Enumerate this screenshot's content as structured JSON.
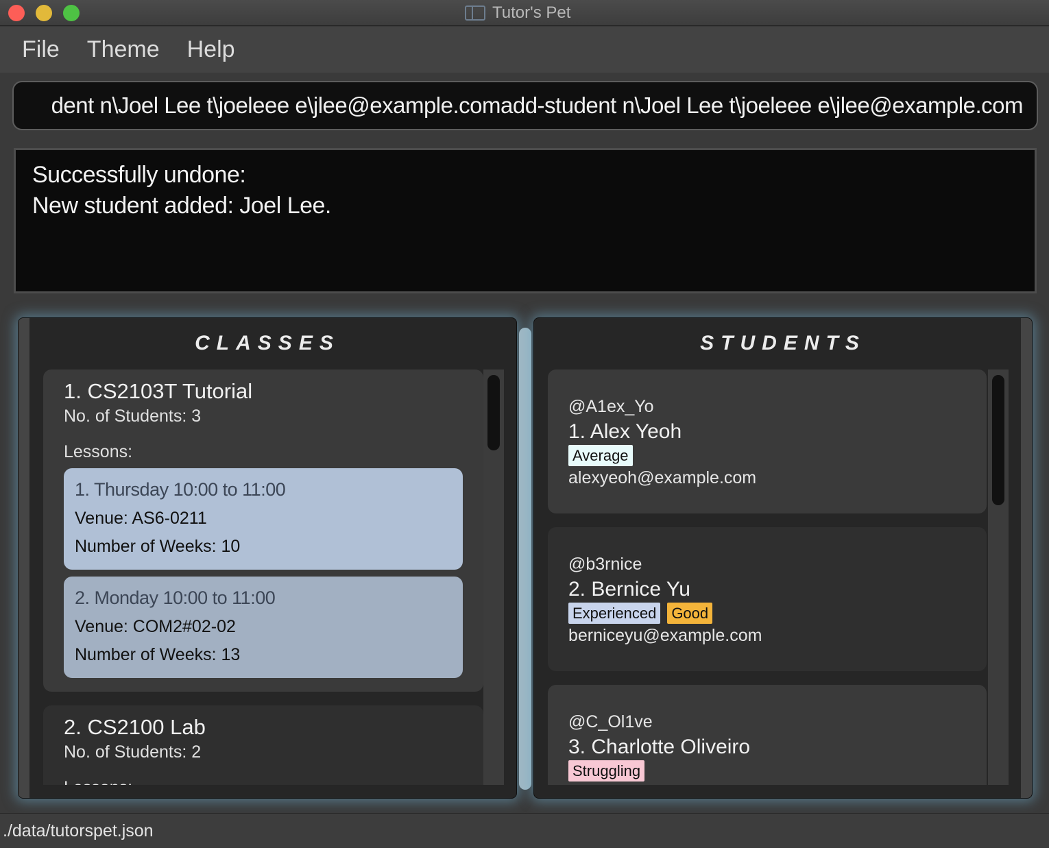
{
  "window": {
    "title": "Tutor's Pet",
    "app_icon": "book-icon"
  },
  "menu": [
    "File",
    "Theme",
    "Help"
  ],
  "command": {
    "value": "dent n\\Joel Lee t\\joeleee e\\jlee@example.comadd-student n\\Joel Lee t\\joeleee e\\jlee@example.com"
  },
  "result": {
    "line1": "Successfully undone:",
    "line2": "New student added: Joel Lee."
  },
  "classes": {
    "title": "CLASSES",
    "items": [
      {
        "name": "1.  CS2103T Tutorial",
        "students": "No. of Students:  3",
        "lessons_label": "Lessons:",
        "lessons": [
          {
            "title": "1. Thursday 10:00 to 11:00",
            "venue": "Venue: AS6-0211",
            "weeks": "Number of Weeks: 10"
          },
          {
            "title": "2. Monday 10:00 to 11:00",
            "venue": "Venue: COM2#02-02",
            "weeks": "Number of Weeks: 13"
          }
        ]
      },
      {
        "name": "2.  CS2100 Lab",
        "students": "No. of Students:  2",
        "lessons_label": "Lessons:"
      }
    ]
  },
  "students": {
    "title": "STUDENTS",
    "items": [
      {
        "handle": "@A1ex_Yo",
        "name": "1.  Alex Yeoh",
        "tags": [
          "Average"
        ],
        "email": "alexyeoh@example.com"
      },
      {
        "handle": "@b3rnice",
        "name": "2.  Bernice Yu",
        "tags": [
          "Experienced",
          "Good"
        ],
        "email": "berniceyu@example.com"
      },
      {
        "handle": "@C_Ol1ve",
        "name": "3.  Charlotte Oliveiro",
        "tags": [
          "Struggling"
        ]
      }
    ]
  },
  "tag_colors": {
    "Average": "#e8fbfb",
    "Experienced": "#c8d4ec",
    "Good": "#f4b43a",
    "Struggling": "#f8c8d4"
  },
  "lesson_colors": [
    "#b0c0d6",
    "#a2b0c2"
  ],
  "status": {
    "path": "./data/tutorspet.json"
  }
}
